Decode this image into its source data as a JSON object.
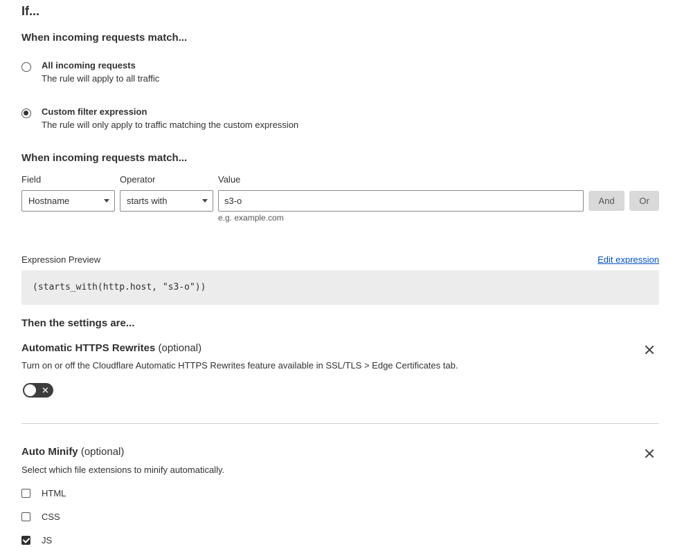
{
  "header": {
    "title": "If..."
  },
  "match_section": {
    "title": "When incoming requests match...",
    "options": [
      {
        "title": "All incoming requests",
        "description": "The rule will apply to all traffic",
        "selected": false
      },
      {
        "title": "Custom filter expression",
        "description": "The rule will only apply to traffic matching the custom expression",
        "selected": true
      }
    ]
  },
  "builder": {
    "title": "When incoming requests match...",
    "field_label": "Field",
    "operator_label": "Operator",
    "value_label": "Value",
    "field_value": "Hostname",
    "operator_value": "starts with",
    "value_input": "s3-o",
    "value_hint": "e.g. example.com",
    "and_label": "And",
    "or_label": "Or"
  },
  "preview": {
    "label": "Expression Preview",
    "edit_link": "Edit expression",
    "expression": "(starts_with(http.host, \"s3-o\"))"
  },
  "settings": {
    "title": "Then the settings are...",
    "https_rewrites": {
      "name": "Automatic HTTPS Rewrites",
      "optional": "(optional)",
      "description": "Turn on or off the Cloudflare Automatic HTTPS Rewrites feature available in SSL/TLS > Edge Certificates tab.",
      "toggle_on": false,
      "toggle_glyph": "✕"
    },
    "auto_minify": {
      "name": "Auto Minify",
      "optional": "(optional)",
      "description": "Select which file extensions to minify automatically.",
      "options": [
        {
          "label": "HTML",
          "checked": false
        },
        {
          "label": "CSS",
          "checked": false
        },
        {
          "label": "JS",
          "checked": true
        }
      ]
    }
  },
  "colors": {
    "link": "#0051c3",
    "text": "#313131",
    "toggle_off": "#3d3d3d",
    "expr_bg": "#ececec"
  }
}
